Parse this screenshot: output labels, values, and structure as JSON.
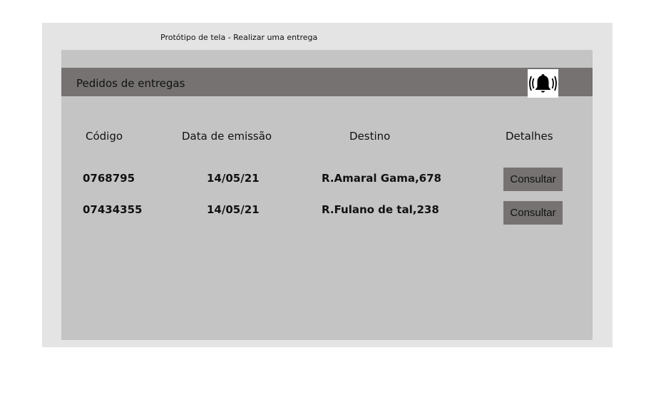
{
  "frame": {
    "title": "Protótipo de tela - Realizar uma entrega"
  },
  "header": {
    "title": "Pedidos de entregas",
    "icon": "bell-alert-icon"
  },
  "table": {
    "columns": [
      "Código",
      "Data de emissão",
      "Destino",
      "Detalhes"
    ],
    "rows": [
      {
        "codigo": "0768795",
        "data": "14/05/21",
        "destino": "R.Amaral Gama,678",
        "acao": "Consultar"
      },
      {
        "codigo": "07434355",
        "data": "14/05/21",
        "destino": "R.Fulano de tal,238",
        "acao": "Consultar"
      }
    ]
  },
  "colors": {
    "frame_bg": "#e4e4e4",
    "screen_bg": "#c4c4c4",
    "header_bg": "#767272",
    "button_bg": "#767272"
  }
}
